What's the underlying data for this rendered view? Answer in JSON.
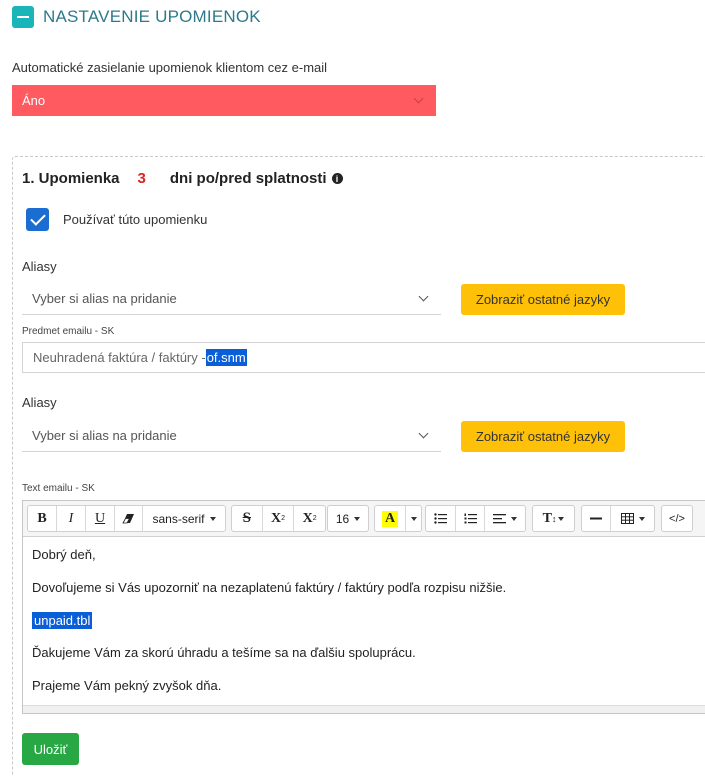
{
  "section": {
    "title": "NASTAVENIE UPOMIENOK"
  },
  "auto_send": {
    "label": "Automatické zasielanie upomienok klientom cez e-mail",
    "selected": "Áno"
  },
  "reminder": {
    "title_prefix": "1. Upomienka",
    "days": "3",
    "title_suffix": "dni po/pred splatnosti",
    "info_glyph": "i",
    "use_label": "Používať túto upomienku",
    "use_checked": true
  },
  "aliases_1": {
    "label": "Aliasy",
    "placeholder": "Vyber si alias na pridanie",
    "languages_button": "Zobraziť ostatné jazyky"
  },
  "subject": {
    "label": "Predmet emailu - SK",
    "value_prefix": "Neuhradená faktúra / faktúry - ",
    "value_tag": "of.snm"
  },
  "aliases_2": {
    "label": "Aliasy",
    "placeholder": "Vyber si alias na pridanie",
    "languages_button": "Zobraziť ostatné jazyky"
  },
  "body_editor": {
    "label": "Text emailu - SK",
    "toolbar": {
      "bold": "B",
      "italic": "I",
      "underline": "U",
      "font_family": "sans-serif",
      "strikethrough": "S",
      "superscript": "X",
      "superscript_mark": "2",
      "subscript": "X",
      "subscript_mark": "2",
      "font_size": "16",
      "text_color": "A",
      "text_color_hex": "#ffff00",
      "font_size_menu": "T",
      "code_view": "</>"
    },
    "paragraphs": [
      "Dobrý deň,",
      "Dovoľujeme si Vás upozorniť na nezaplatenú faktúry / faktúry podľa rozpisu nižšie.",
      "unpaid.tbl",
      "Ďakujeme Vám za skorú úhradu a tešíme sa na ďalšiu spoluprácu.",
      "Prajeme Vám pekný zvyšok dňa."
    ]
  },
  "save_button": "Uložiť",
  "colors": {
    "accent_teal": "#1ab5b8",
    "select_red": "#ff5a5f",
    "button_yellow": "#ffc107",
    "save_green": "#28a745",
    "selection_blue": "#0a5fd8",
    "checkbox_blue": "#1b6ed1"
  }
}
